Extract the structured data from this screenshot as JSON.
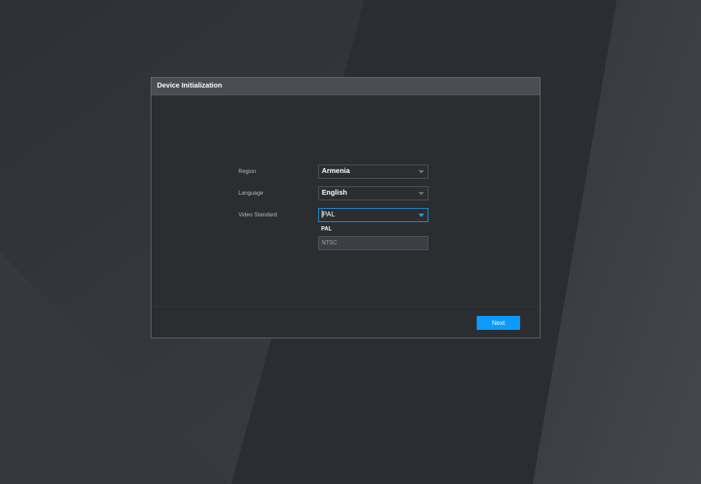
{
  "dialog": {
    "title": "Device Initialization"
  },
  "form": {
    "region": {
      "label": "Region",
      "value": "Armenia"
    },
    "language": {
      "label": "Language",
      "value": "English"
    },
    "video_standard": {
      "label": "Video Standard",
      "value": "PAL",
      "options": [
        "PAL",
        "NTSC"
      ]
    }
  },
  "footer": {
    "next_label": "Next"
  },
  "colors": {
    "accent": "#0c9aff",
    "focus_border": "#1aa4ff",
    "dialog_bg": "#2b2d31",
    "header_bg": "#4b4d52"
  },
  "icons": {
    "dropdown_caret": "chevron-down-icon"
  }
}
